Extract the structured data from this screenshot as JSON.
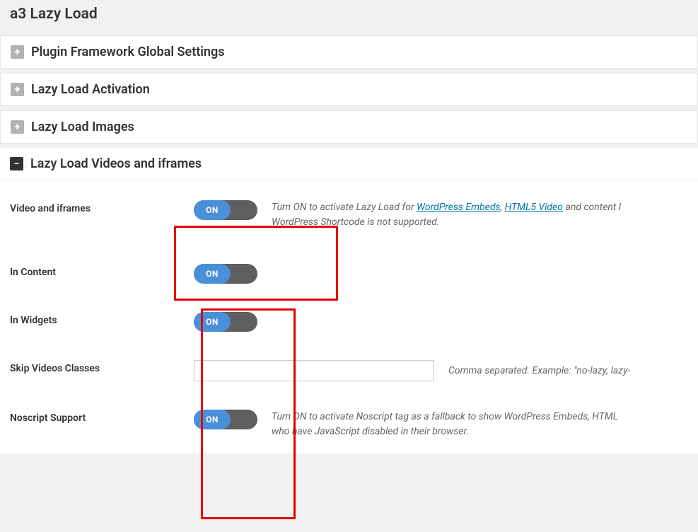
{
  "page": {
    "title": "a3 Lazy Load"
  },
  "panels": {
    "framework": {
      "title": "Plugin Framework Global Settings"
    },
    "activation": {
      "title": "Lazy Load Activation"
    },
    "images": {
      "title": "Lazy Load Images"
    },
    "videos": {
      "title": "Lazy Load Videos and iframes"
    }
  },
  "toggle_labels": {
    "on": "ON"
  },
  "fields": {
    "video_iframes": {
      "label": "Video and iframes",
      "help_1": "Turn ON to activate Lazy Load for ",
      "link1": "WordPress Embeds",
      "help_2": ", ",
      "link2": "HTML5 Video",
      "help_3": " and content l",
      "help_line2": "WordPress Shortcode is not supported."
    },
    "in_content": {
      "label": "In Content"
    },
    "in_widgets": {
      "label": "In Widgets"
    },
    "skip_classes": {
      "label": "Skip Videos Classes",
      "value": "",
      "help": "Comma separated. Example: \"no-lazy, lazy-"
    },
    "noscript": {
      "label": "Noscript Support",
      "help_1": "Turn ON to activate Noscript tag as a fallback to show WordPress Embeds, HTML",
      "help_2": "who have JavaScript disabled in their browser."
    }
  }
}
